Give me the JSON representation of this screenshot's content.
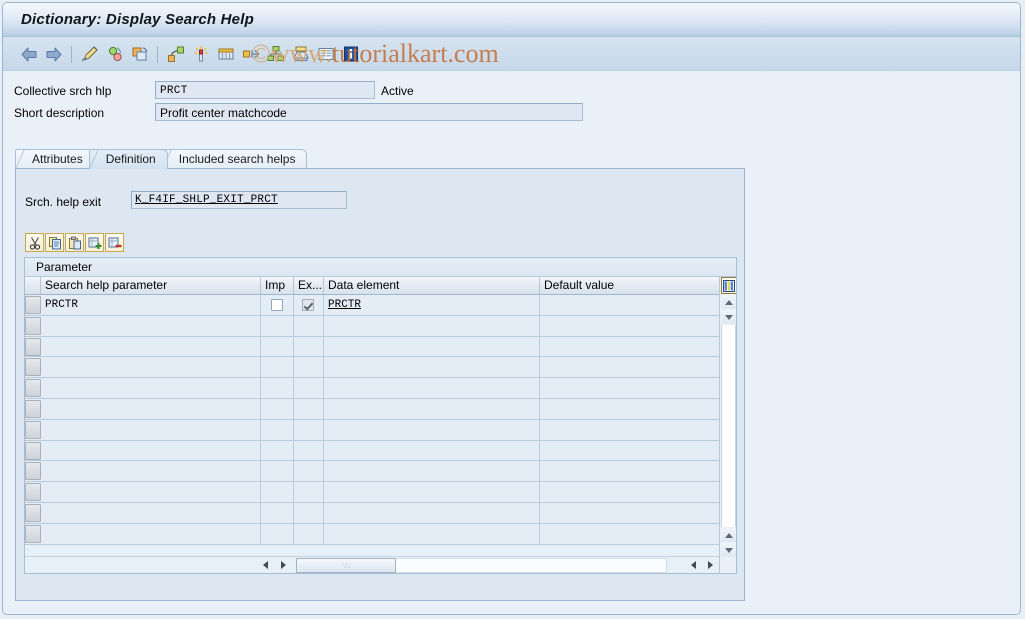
{
  "window": {
    "title": "Dictionary: Display Search Help"
  },
  "watermark": {
    "prefix": "©www.",
    "brand": "tutorialkart.com"
  },
  "toolbar": {
    "items": [
      {
        "name": "back-icon",
        "tooltip": "Back"
      },
      {
        "name": "forward-icon",
        "tooltip": "Forward"
      },
      {
        "name": "separator-1",
        "tooltip": ""
      },
      {
        "name": "display-change-icon",
        "tooltip": "Display <-> Change"
      },
      {
        "name": "check-icon",
        "tooltip": "Check"
      },
      {
        "name": "copy-object-icon",
        "tooltip": "Copy"
      },
      {
        "name": "separator-2",
        "tooltip": ""
      },
      {
        "name": "where-used-icon",
        "tooltip": "Where-Used List"
      },
      {
        "name": "test-icon",
        "tooltip": "Test"
      },
      {
        "name": "technical-settings-icon",
        "tooltip": "Technical Settings"
      },
      {
        "name": "expand-icon",
        "tooltip": "Expand"
      },
      {
        "name": "hierarchy-icon",
        "tooltip": "Hierarchy"
      },
      {
        "name": "print-icon",
        "tooltip": "Print"
      },
      {
        "name": "documentation-icon",
        "tooltip": "Documentation"
      },
      {
        "name": "info-icon",
        "tooltip": "Information"
      }
    ]
  },
  "header_form": {
    "collective_label": "Collective srch hlp",
    "collective_value": "PRCT",
    "status": "Active",
    "short_desc_label": "Short description",
    "short_desc_value": "Profit center matchcode"
  },
  "tabs": [
    {
      "label": "Attributes",
      "active": false
    },
    {
      "label": "Definition",
      "active": true
    },
    {
      "label": "Included search helps",
      "active": false
    }
  ],
  "definition": {
    "exit_label": "Srch. help exit",
    "exit_value": "K_F4IF_SHLP_EXIT_PRCT"
  },
  "grid_toolbar": {
    "items": [
      {
        "name": "cut-icon",
        "tooltip": "Cut"
      },
      {
        "name": "copy-icon",
        "tooltip": "Copy"
      },
      {
        "name": "paste-icon",
        "tooltip": "Paste"
      },
      {
        "name": "insert-row-icon",
        "tooltip": "Insert Row"
      },
      {
        "name": "delete-row-icon",
        "tooltip": "Delete Row"
      }
    ]
  },
  "grid": {
    "title": "Parameter",
    "columns": [
      {
        "key": "param",
        "label": "Search help parameter"
      },
      {
        "key": "imp",
        "label": "Imp"
      },
      {
        "key": "exp",
        "label": "Ex..."
      },
      {
        "key": "dataelem",
        "label": "Data element"
      },
      {
        "key": "default",
        "label": "Default value"
      }
    ],
    "rows": [
      {
        "param": "PRCTR",
        "imp": false,
        "exp": true,
        "dataelem": "PRCTR",
        "default": ""
      },
      {
        "param": "",
        "imp": null,
        "exp": null,
        "dataelem": "",
        "default": ""
      },
      {
        "param": "",
        "imp": null,
        "exp": null,
        "dataelem": "",
        "default": ""
      },
      {
        "param": "",
        "imp": null,
        "exp": null,
        "dataelem": "",
        "default": ""
      },
      {
        "param": "",
        "imp": null,
        "exp": null,
        "dataelem": "",
        "default": ""
      },
      {
        "param": "",
        "imp": null,
        "exp": null,
        "dataelem": "",
        "default": ""
      },
      {
        "param": "",
        "imp": null,
        "exp": null,
        "dataelem": "",
        "default": ""
      },
      {
        "param": "",
        "imp": null,
        "exp": null,
        "dataelem": "",
        "default": ""
      },
      {
        "param": "",
        "imp": null,
        "exp": null,
        "dataelem": "",
        "default": ""
      },
      {
        "param": "",
        "imp": null,
        "exp": null,
        "dataelem": "",
        "default": ""
      },
      {
        "param": "",
        "imp": null,
        "exp": null,
        "dataelem": "",
        "default": ""
      },
      {
        "param": "",
        "imp": null,
        "exp": null,
        "dataelem": "",
        "default": ""
      }
    ],
    "column_config_icon": "column-config-icon"
  },
  "colors": {
    "page_background": "#e9eff7",
    "titlebar_top": "#f4f8fc",
    "titlebar_bottom": "#b6cce3",
    "toolbar_background": "#cdddec",
    "panel_background": "#dce7f2",
    "grid_row": "#e4edf6",
    "field_background": "#dfe8f2",
    "border": "#9bb5d0",
    "watermark": "#c4703a"
  }
}
